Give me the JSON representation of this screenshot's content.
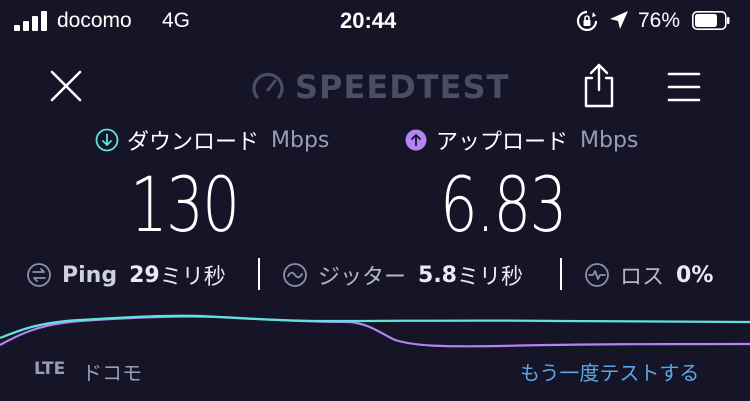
{
  "status_bar": {
    "carrier": "docomo",
    "network": "4G",
    "time": "20:44",
    "battery": "76%",
    "battery_level": 0.76
  },
  "header": {
    "logo_text": "SPEEDTEST",
    "close_icon": "close-icon",
    "share_icon": "share-icon",
    "menu_icon": "hamburger-menu-icon"
  },
  "download": {
    "label": "ダウンロード",
    "unit": "Mbps",
    "value": "130",
    "color": "#5fe3dc"
  },
  "upload": {
    "label": "アップロード",
    "unit": "Mbps",
    "value": "6.83",
    "color": "#b484f2"
  },
  "stats": {
    "ping": {
      "label": "Ping",
      "value": "29",
      "unit": "ミリ秒"
    },
    "jitter": {
      "label": "ジッター",
      "value": "5.8",
      "unit": "ミリ秒"
    },
    "loss": {
      "label": "ロス",
      "value": "0%"
    }
  },
  "footer": {
    "connection": "LTE",
    "provider": "ドコモ",
    "retest": "もう一度テストする"
  },
  "colors": {
    "background": "#151527",
    "download_line": "#5fe3dc",
    "upload_line": "#b484f2",
    "link": "#5aa7e6"
  }
}
